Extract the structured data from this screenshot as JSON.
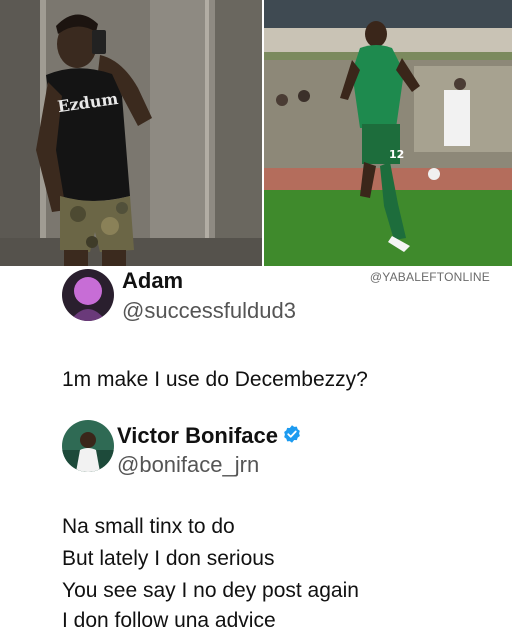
{
  "watermark": "@YABALEFTONLINE",
  "photos": {
    "left_shirt_text": "Ezdum",
    "right_jersey_number": "12"
  },
  "tweet1": {
    "name": "Adam",
    "handle": "@successfuldud3",
    "text": "1m make I use do Decembezzy?"
  },
  "tweet2": {
    "name": "Victor Boniface",
    "handle": "@boniface_jrn",
    "verified_color": "#1d9bf0",
    "lines": [
      "Na small tinx to do",
      "But lately I don serious",
      "You see say I no dey post again",
      "I don follow una advice"
    ]
  }
}
